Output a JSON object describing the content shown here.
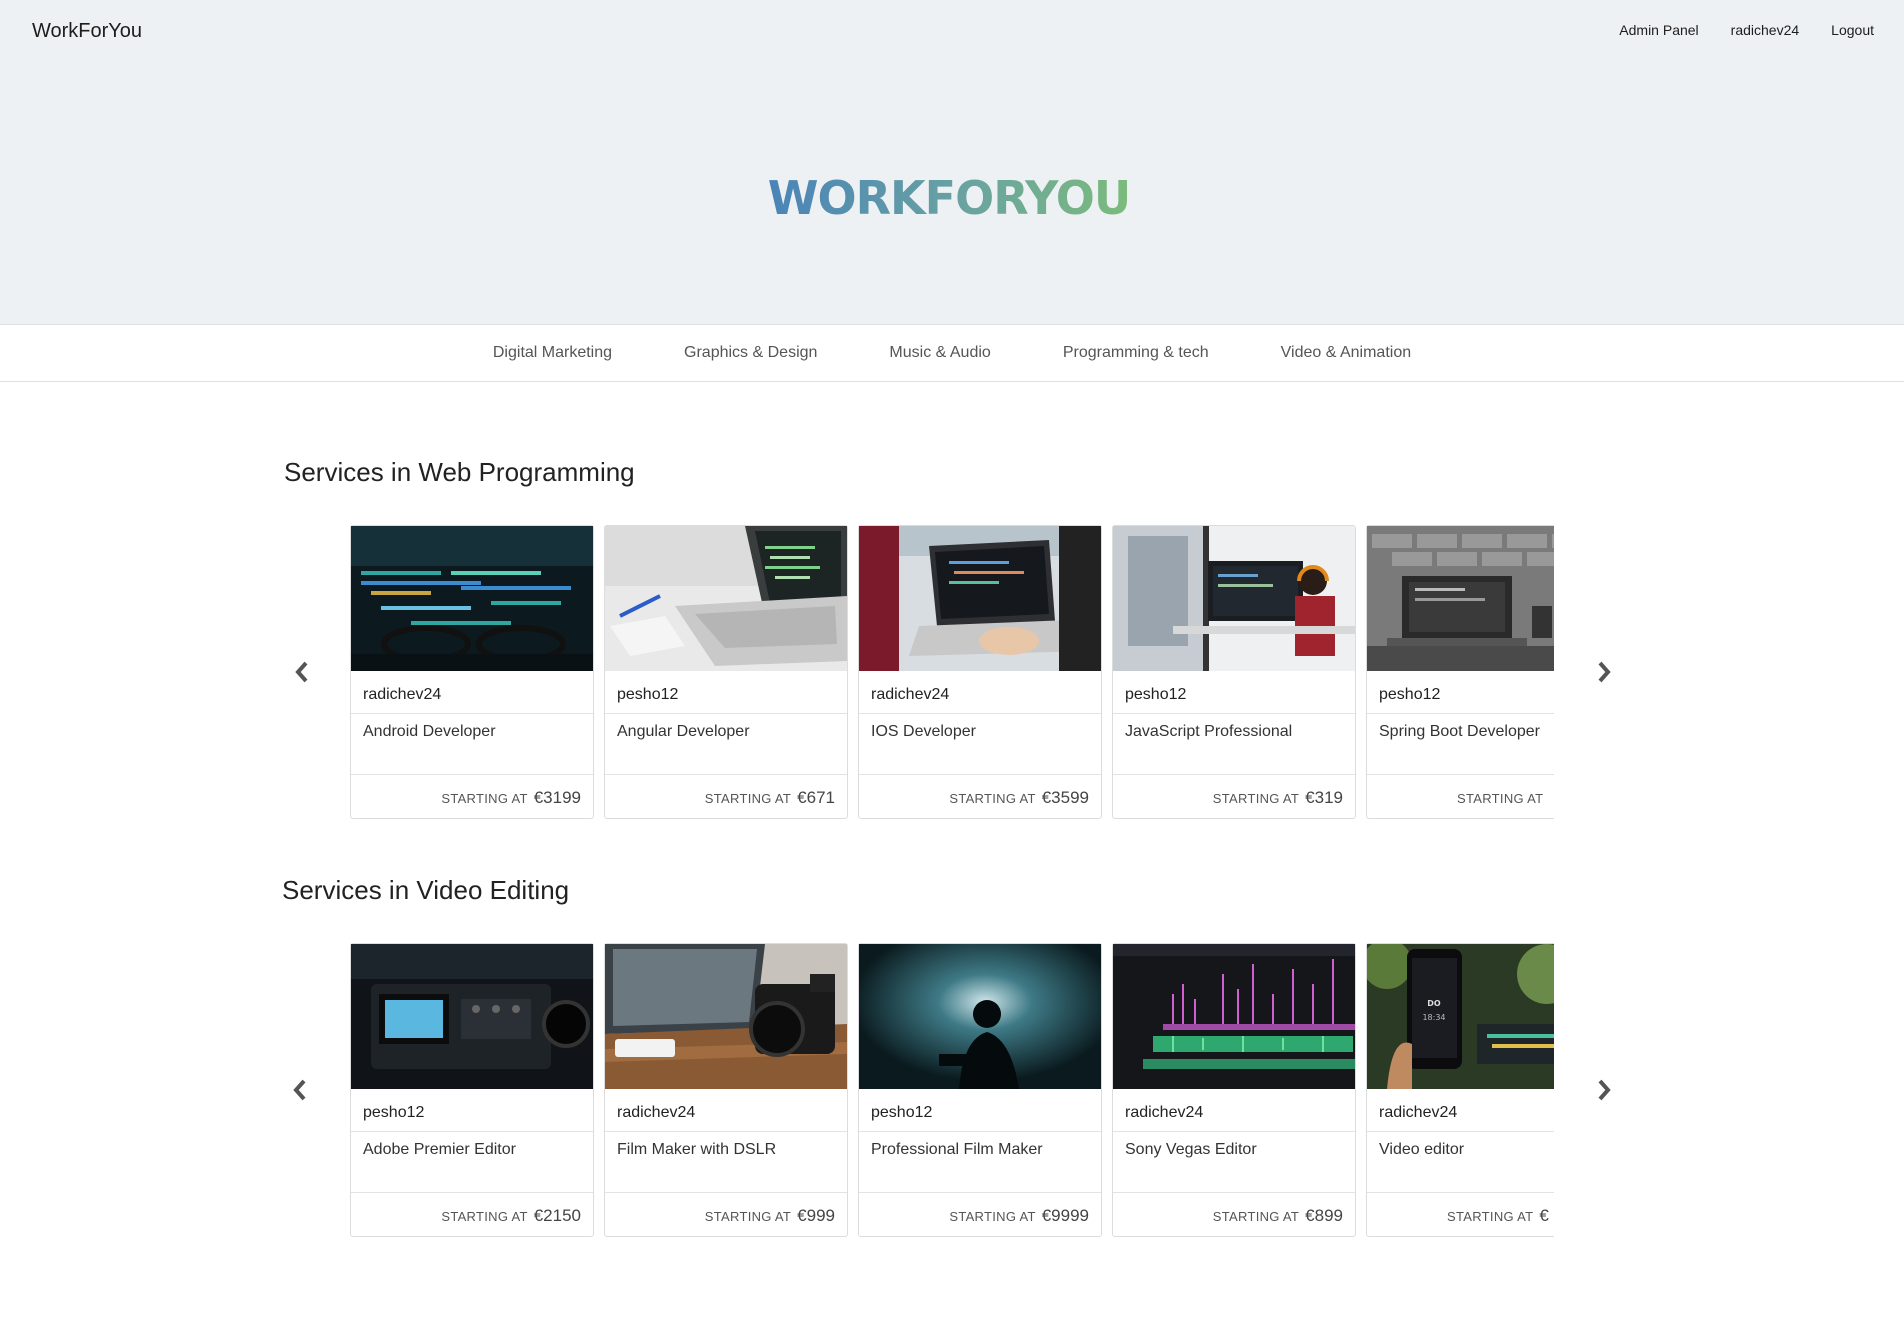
{
  "nav": {
    "brand": "WorkForYou",
    "links": [
      "Admin Panel",
      "radichev24",
      "Logout"
    ]
  },
  "hero": {
    "logo_text": "WORKFORYOU"
  },
  "categories": [
    "Digital Marketing",
    "Graphics & Design",
    "Music & Audio",
    "Programming & tech",
    "Video & Animation"
  ],
  "sections": [
    {
      "title": "Services in Web Programming",
      "cards": [
        {
          "seller": "radichev24",
          "title": "Android Developer",
          "starting": "STARTING AT",
          "price": "€3199",
          "image": "code-monitor-glasses"
        },
        {
          "seller": "pesho12",
          "title": "Angular Developer",
          "starting": "STARTING AT",
          "price": "€671",
          "image": "laptop-notebook"
        },
        {
          "seller": "radichev24",
          "title": "IOS Developer",
          "starting": "STARTING AT",
          "price": "€3599",
          "image": "person-laptop-window"
        },
        {
          "seller": "pesho12",
          "title": "JavaScript Professional",
          "starting": "STARTING AT",
          "price": "€319",
          "image": "woman-headphones-monitors"
        },
        {
          "seller": "pesho12",
          "title": "Spring Boot Developer",
          "starting": "STARTING AT",
          "price": "",
          "image": "laptop-brick-wall"
        }
      ]
    },
    {
      "title": "Services in Video Editing",
      "cards": [
        {
          "seller": "pesho12",
          "title": "Adobe Premier Editor",
          "starting": "STARTING AT",
          "price": "€2150",
          "image": "video-camera"
        },
        {
          "seller": "radichev24",
          "title": "Film Maker with DSLR",
          "starting": "STARTING AT",
          "price": "€999",
          "image": "dslr-laptop-desk"
        },
        {
          "seller": "pesho12",
          "title": "Professional Film Maker",
          "starting": "STARTING AT",
          "price": "€9999",
          "image": "silhouette-camera"
        },
        {
          "seller": "radichev24",
          "title": "Sony Vegas Editor",
          "starting": "STARTING AT",
          "price": "€899",
          "image": "editing-timeline"
        },
        {
          "seller": "radichev24",
          "title": "Video editor",
          "starting": "STARTING AT",
          "price": "€",
          "image": "phone-in-hand"
        }
      ]
    }
  ],
  "colors": {
    "hero_bg": "#eef1f4",
    "logo_blue": "#4f86b5",
    "logo_green": "#77b77f"
  }
}
